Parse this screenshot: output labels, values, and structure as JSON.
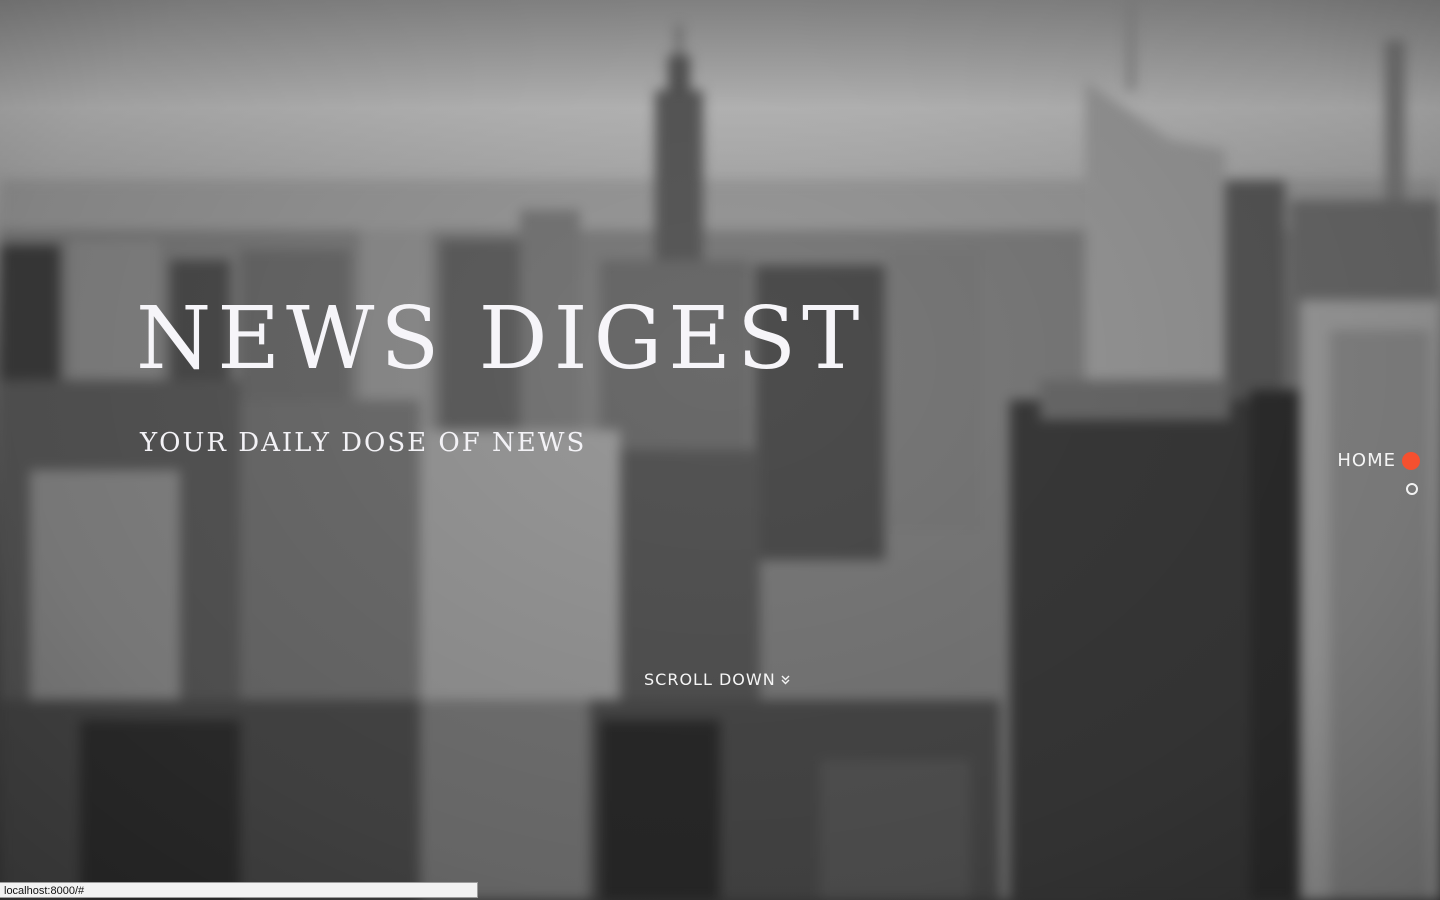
{
  "hero": {
    "title": "NEWS DIGEST",
    "subtitle": "YOUR DAILY DOSE OF NEWS",
    "scroll_label": "SCROLL DOWN",
    "scroll_icon": "double-chevron-down-icon"
  },
  "side_nav": {
    "items": [
      {
        "label": "HOME",
        "active": true
      },
      {
        "label": "",
        "active": false
      }
    ],
    "active_color": "#f5502f"
  },
  "status_bar": {
    "url": "localhost:8000/#"
  }
}
